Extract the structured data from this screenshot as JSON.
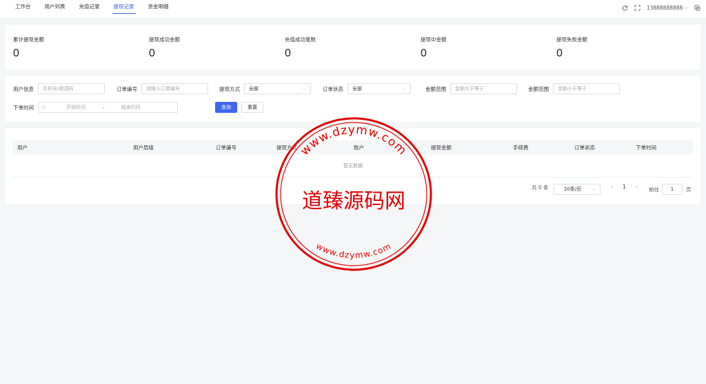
{
  "topbar": {
    "tabs": [
      {
        "label": "工作台"
      },
      {
        "label": "用户列表"
      },
      {
        "label": "充值记录"
      },
      {
        "label": "提现记录",
        "active": true
      },
      {
        "label": "资金明细"
      }
    ],
    "account": "13888888888",
    "refresh_icon": "refresh-icon",
    "fullscreen_icon": "fullscreen-icon",
    "settings_icon": "gear-icon"
  },
  "stats": [
    {
      "label": "累计提现金额",
      "value": "0"
    },
    {
      "label": "提现成功金额",
      "value": "0"
    },
    {
      "label": "充值成功笔数",
      "value": "0"
    },
    {
      "label": "提现中金额",
      "value": "0"
    },
    {
      "label": "提现失败金额",
      "value": "0"
    }
  ],
  "filters": {
    "user_info": {
      "label": "用户信息",
      "placeholder": "手机号/邀请码"
    },
    "order_no": {
      "label": "订单编号",
      "placeholder": "请输入订单编号"
    },
    "withdraw_method": {
      "label": "提现方式",
      "value": "全部"
    },
    "order_status": {
      "label": "订单状态",
      "value": "全部"
    },
    "amount_min": {
      "label": "金额范围",
      "placeholder": "金额大于等于"
    },
    "amount_max": {
      "label": "金额范围",
      "placeholder": "金额小于等于"
    },
    "order_time": {
      "label": "下单时间",
      "start": "开始时间",
      "sep": "–",
      "end": "结束时间"
    },
    "search_label": "查询",
    "reset_label": "重置"
  },
  "table": {
    "columns": [
      "用户",
      "用户层级",
      "订单编号",
      "提现方式",
      "账户",
      "提现金额",
      "手续费",
      "订单状态",
      "下单时间"
    ],
    "empty_text": "暂无数据"
  },
  "pagination": {
    "total": "共 0 条",
    "page_size": "20条/页",
    "prev": "‹",
    "current": "1",
    "next": "›",
    "goto_label": "前往",
    "goto_value": "1",
    "page_unit": "页"
  },
  "watermark": {
    "text": "道臻源码网",
    "url_top": "www.dzymw.com",
    "url_bottom": "www.dzymw.com",
    "color": "#e00000"
  },
  "colors": {
    "accent": "#4066f2",
    "background": "#f5f6f8"
  }
}
